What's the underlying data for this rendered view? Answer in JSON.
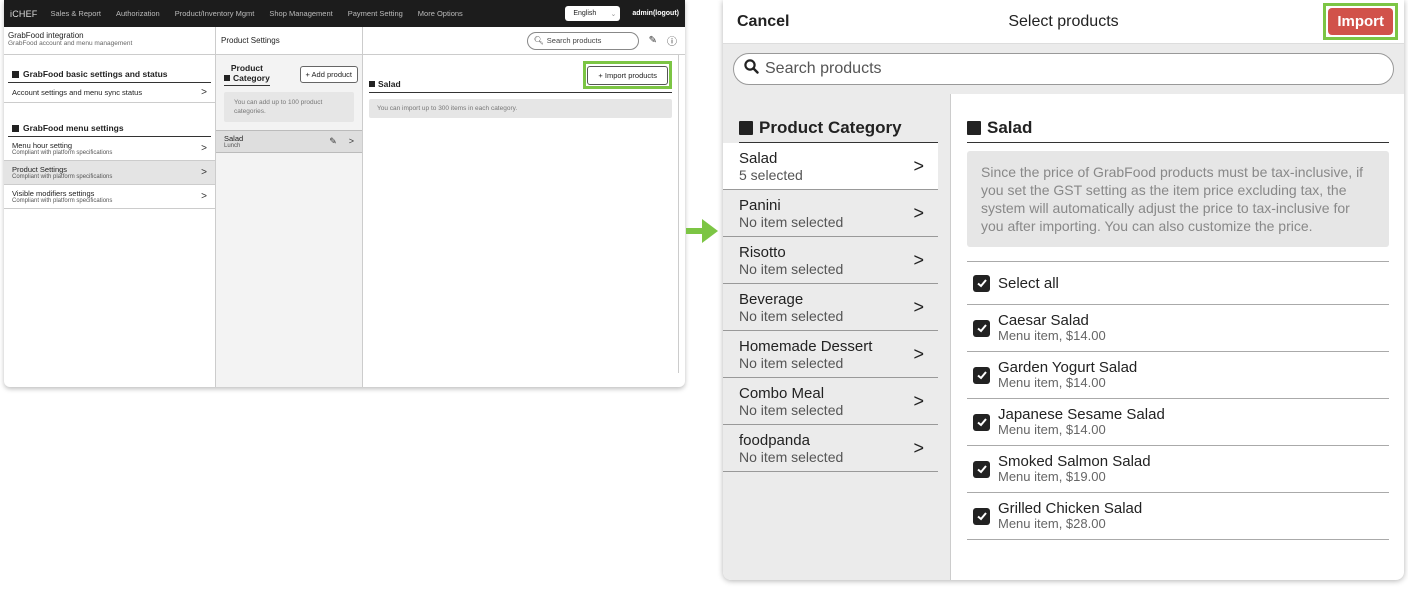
{
  "left": {
    "topnav": {
      "brand": "iCHEF",
      "items": [
        "Sales & Report",
        "Authorization",
        "Product/Inventory Mgmt",
        "Shop Management",
        "Payment Setting",
        "More Options"
      ],
      "language": "English",
      "admin": "admin(logout)"
    },
    "sidebar": {
      "title": "GrabFood integration",
      "subtitle": "GrabFood account and menu management",
      "section1": "GrabFood basic settings and status",
      "section1_items": [
        {
          "label": "Account settings and menu sync status",
          "sub": ""
        }
      ],
      "section2": "GrabFood menu settings",
      "section2_items": [
        {
          "label": "Menu hour setting",
          "sub": "Compliant with platform specifications"
        },
        {
          "label": "Product Settings",
          "sub": "Compliant with platform specifications"
        },
        {
          "label": "Visible modifiers settings",
          "sub": "Compliant with platform specifications"
        }
      ]
    },
    "product_settings": {
      "header": "Product Settings",
      "category_title_line1": "Product",
      "category_title_line2": "Category",
      "add_product": "+ Add product",
      "category_note": "You can add up to 100 product categories.",
      "category_row": {
        "label": "Salad",
        "sub": "Lunch"
      },
      "search_placeholder": "Search products",
      "salad_title": "Salad",
      "import_products": "+ Import products",
      "import_note": "You can import up to 300 items in each category."
    }
  },
  "right": {
    "cancel": "Cancel",
    "title": "Select products",
    "import": "Import",
    "search_placeholder": "Search products",
    "category_title": "Product Category",
    "categories": [
      {
        "name": "Salad",
        "status": "5 selected"
      },
      {
        "name": "Panini",
        "status": "No item selected"
      },
      {
        "name": "Risotto",
        "status": "No item selected"
      },
      {
        "name": "Beverage",
        "status": "No item selected"
      },
      {
        "name": "Homemade Dessert",
        "status": "No item selected"
      },
      {
        "name": "Combo Meal",
        "status": "No item selected"
      },
      {
        "name": "foodpanda",
        "status": "No item selected"
      }
    ],
    "section_title": "Salad",
    "note": "Since the price of GrabFood products must be tax-inclusive, if you set the GST setting as the item price excluding tax, the system will automatically adjust the price to tax-inclusive for you after importing. You can also customize the price.",
    "select_all": "Select all",
    "items": [
      {
        "name": "Caesar Salad",
        "desc": "Menu item, $14.00"
      },
      {
        "name": "Garden Yogurt Salad",
        "desc": "Menu item, $14.00"
      },
      {
        "name": "Japanese Sesame Salad",
        "desc": "Menu item, $14.00"
      },
      {
        "name": "Smoked Salmon Salad",
        "desc": "Menu item, $19.00"
      },
      {
        "name": "Grilled Chicken Salad",
        "desc": "Menu item, $28.00"
      }
    ]
  },
  "colors": {
    "highlight": "#7cc544",
    "import_button": "#d1524a",
    "nav_bg": "#1c1c1c"
  }
}
